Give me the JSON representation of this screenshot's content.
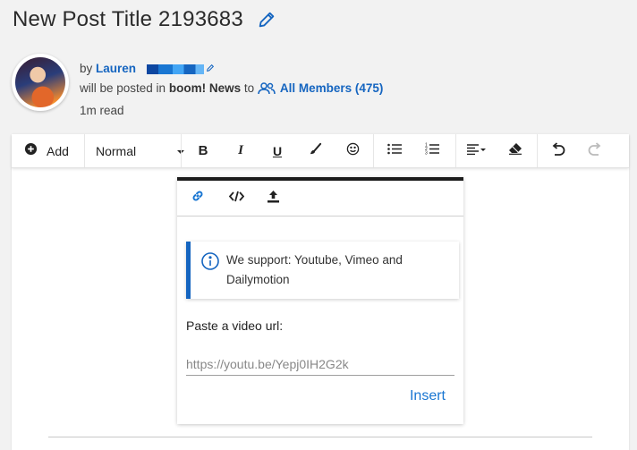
{
  "post": {
    "title": "New Post Title 2193683"
  },
  "author": {
    "by_prefix": "by",
    "name": "Lauren",
    "posted_in_text": "will be posted in",
    "channel": "boom! News",
    "to_text": "to",
    "audience": "All Members (475)",
    "read_time": "1m read"
  },
  "toolbar": {
    "add_label": "Add",
    "style_value": "Normal",
    "icons": [
      "add-icon",
      "bold-icon",
      "italic-icon",
      "underline-icon",
      "brush-icon",
      "emoji-icon",
      "bullet-list-icon",
      "numbered-list-icon",
      "align-icon",
      "eraser-icon",
      "undo-icon",
      "redo-icon"
    ]
  },
  "embed_popup": {
    "tabs": [
      "link-icon",
      "code-icon",
      "upload-icon"
    ],
    "info_text": "We support: Youtube, Vimeo and Dailymotion",
    "paste_label": "Paste a video url:",
    "url_placeholder": "https://youtu.be/Yepj0IH2G2k",
    "insert_label": "Insert"
  },
  "colors": {
    "accent": "#1976d2",
    "link": "#1565c0",
    "background": "#f2f2f2"
  }
}
